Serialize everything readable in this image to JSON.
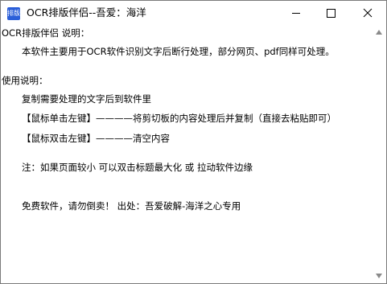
{
  "window": {
    "icon_text": "排版",
    "title": "OCR排版伴侣--吾爱：海洋",
    "colors": {
      "icon_bg": "#2b5fd9"
    }
  },
  "content": {
    "lines": [
      "OCR排版伴侣 说明：",
      "本软件主要用于OCR软件识别文字后断行处理，部分网页、pdf同样可处理。",
      "使用说明：",
      "复制需要处理的文字后到软件里",
      "【鼠标单击左键】————将剪切板的内容处理后并复制（直接去粘贴即可）",
      "【鼠标双击左键】————清空内容",
      "注：如果页面较小   可以双击标题最大化 或 拉动软件边缘",
      "免费软件，请勿倒卖！ 出处：吾爱破解-海洋之心专用"
    ]
  },
  "icons": {
    "minimize": "minimize-icon",
    "maximize": "maximize-icon",
    "close": "close-icon",
    "scroll_up": "chevron-up-icon",
    "scroll_down": "chevron-down-icon"
  }
}
